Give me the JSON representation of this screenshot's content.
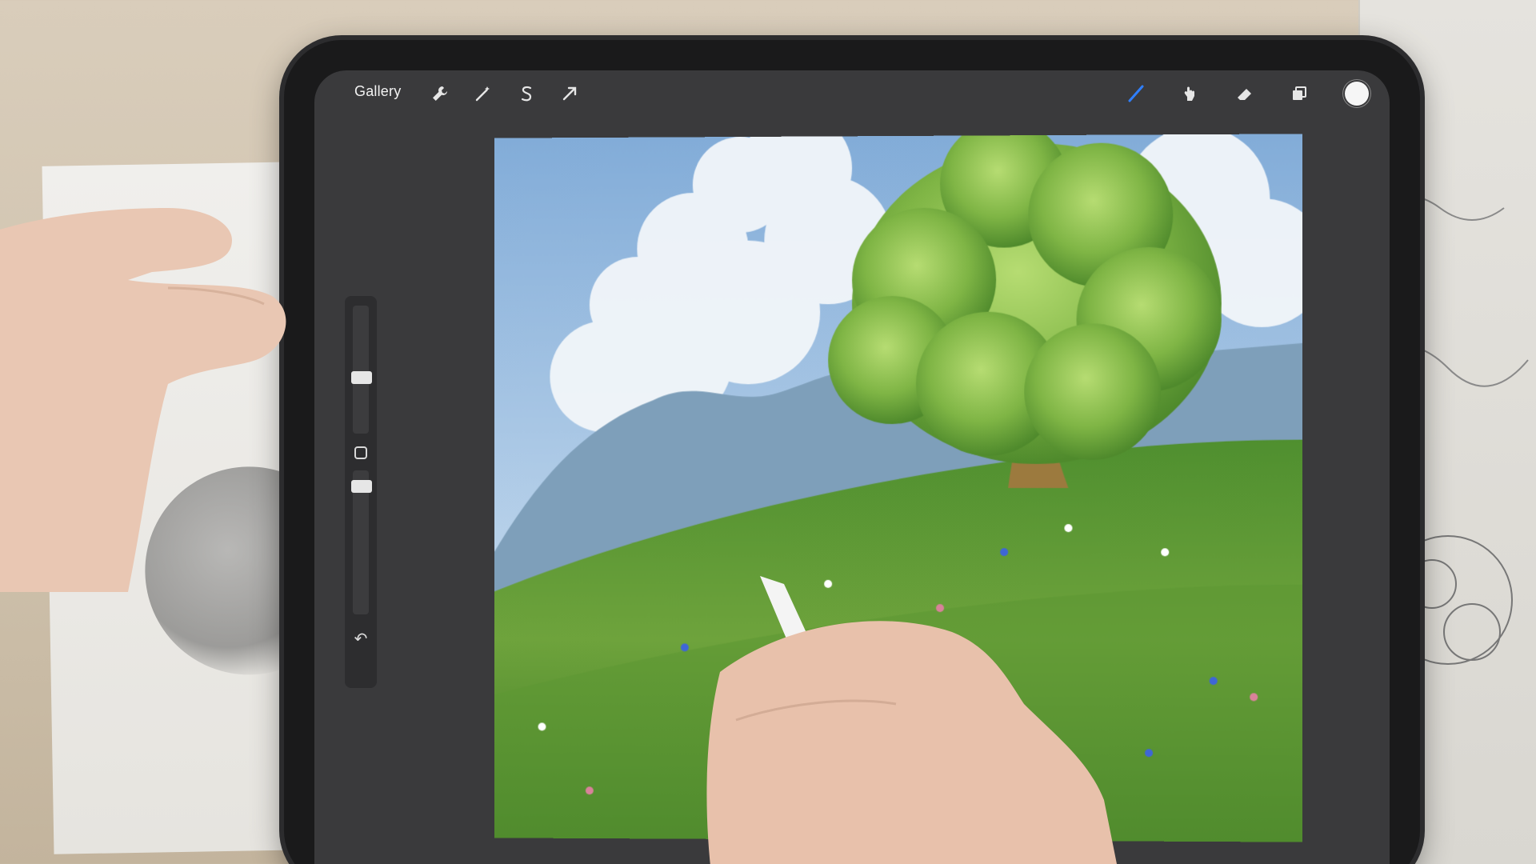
{
  "toolbar": {
    "gallery_label": "Gallery",
    "left_tools": [
      {
        "name": "actions-wrench-icon"
      },
      {
        "name": "adjustments-wand-icon"
      },
      {
        "name": "selection-s-icon"
      },
      {
        "name": "transform-arrow-icon"
      }
    ],
    "right_tools": [
      {
        "name": "brush-icon",
        "active_color": "#2f7fff"
      },
      {
        "name": "smudge-icon"
      },
      {
        "name": "eraser-icon"
      },
      {
        "name": "layers-icon"
      }
    ],
    "current_color": "#f6f6f6"
  },
  "side_panel": {
    "brush_size_level": 0.55,
    "opacity_level": 0.15
  },
  "colors": {
    "ui_dark": "#3a3a3c",
    "accent_blue": "#2f7fff",
    "sky_top": "#8fb6dc",
    "grass": "#6ea33c"
  }
}
